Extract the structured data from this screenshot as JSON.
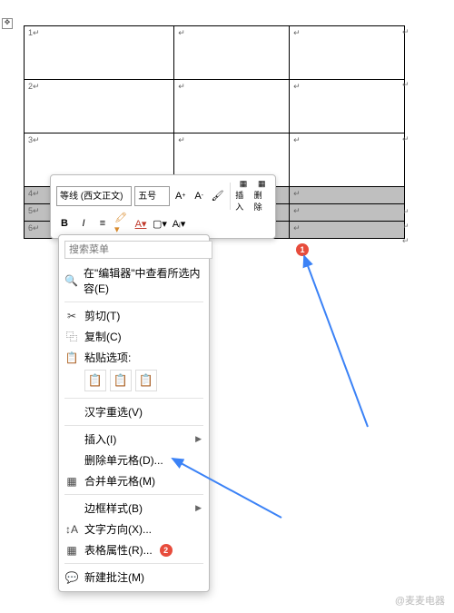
{
  "table": {
    "rows": [
      "1",
      "2",
      "3",
      "4",
      "5",
      "6"
    ]
  },
  "miniToolbar": {
    "font": "等线 (西文正文)",
    "size": "五号",
    "increaseFont": "A↑",
    "decreaseFont": "A↓",
    "formatPainter": "✎",
    "bold": "B",
    "italic": "I",
    "insertLabel": "插入",
    "deleteLabel": "删除"
  },
  "contextMenu": {
    "searchPlaceholder": "搜索菜单",
    "editorLookup": "在\"编辑器\"中查看所选内容(E)",
    "cut": "剪切(T)",
    "copy": "复制(C)",
    "pasteOptions": "粘贴选项:",
    "chineseReselect": "汉字重选(V)",
    "insert": "插入(I)",
    "deleteCells": "删除单元格(D)...",
    "mergeCells": "合并单元格(M)",
    "borderStyles": "边框样式(B)",
    "textDirection": "文字方向(X)...",
    "tableProperties": "表格属性(R)...",
    "newComment": "新建批注(M)"
  },
  "badges": {
    "one": "1",
    "two": "2"
  },
  "watermark": "@麦麦电器"
}
